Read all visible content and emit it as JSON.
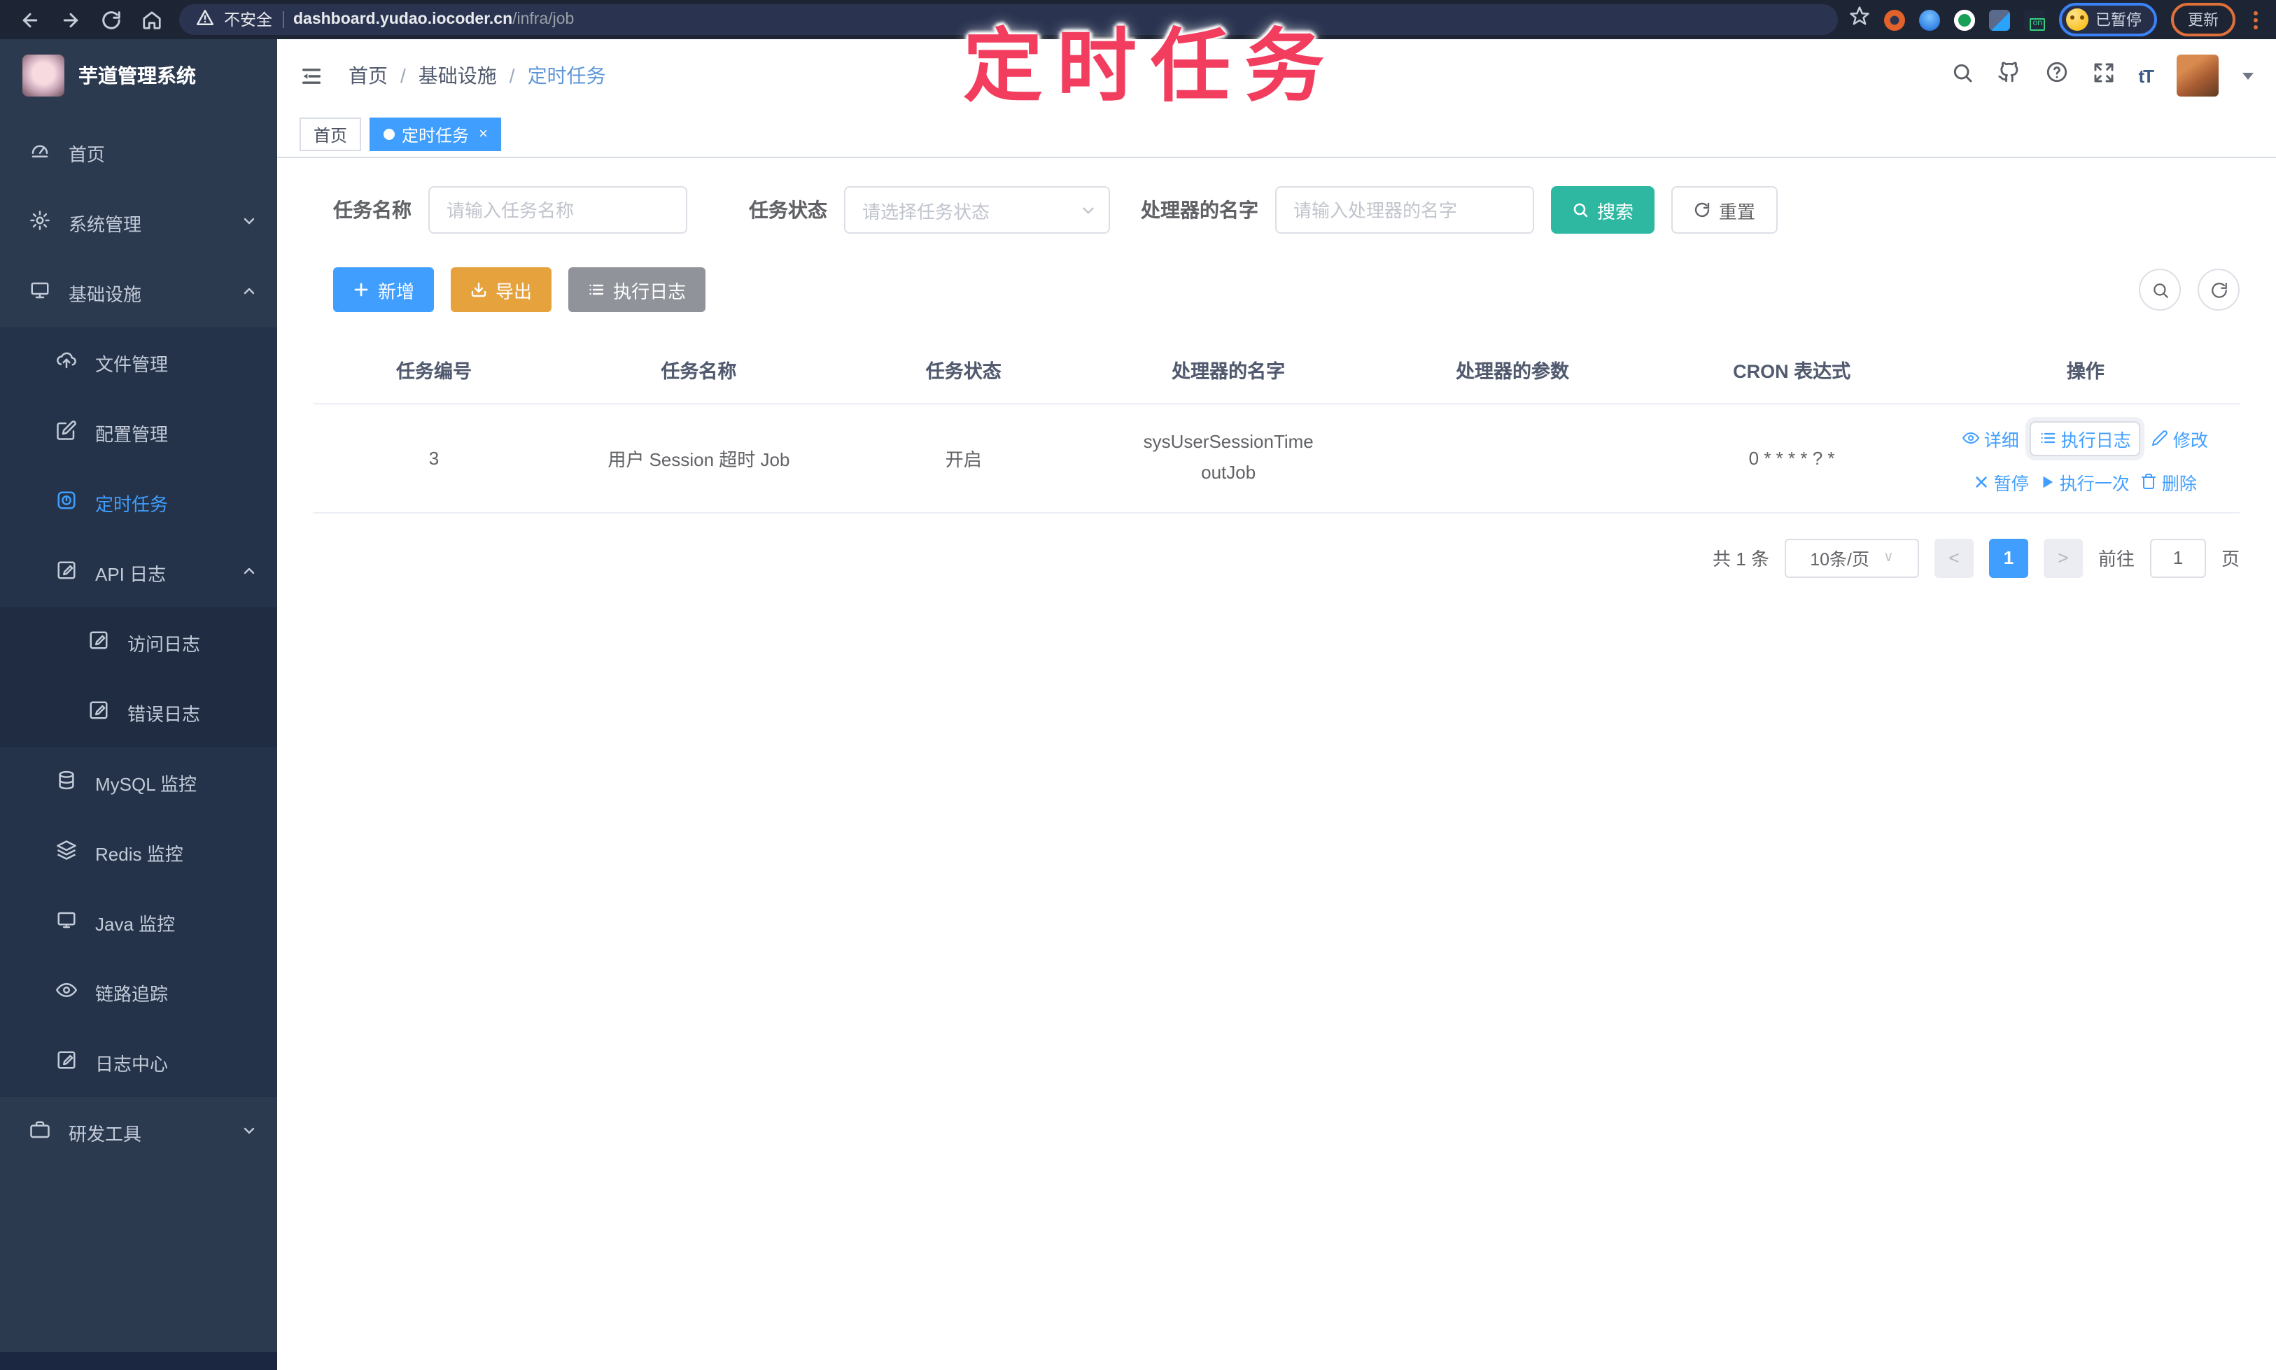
{
  "colors": {
    "accent": "#409eff",
    "search_button": "#2eb8a2",
    "export_button": "#e6a23c",
    "info_button": "#909399",
    "overlay_red": "#f23d5e",
    "sidebar_bg": "#2c3a50"
  },
  "overlay_text": "定时任务",
  "browser": {
    "security_label": "不安全",
    "url_domain": "dashboard.yudao.iocoder.cn",
    "url_path": "/infra/job",
    "ext_on_badge": "on",
    "profile_label": "已暂停",
    "update_label": "更新"
  },
  "sidebar": {
    "title": "芋道管理系统",
    "items": [
      {
        "label": "首页"
      },
      {
        "label": "系统管理"
      },
      {
        "label": "基础设施"
      },
      {
        "label": "文件管理"
      },
      {
        "label": "配置管理"
      },
      {
        "label": "定时任务"
      },
      {
        "label": "API 日志"
      },
      {
        "label": "访问日志"
      },
      {
        "label": "错误日志"
      },
      {
        "label": "MySQL 监控"
      },
      {
        "label": "Redis 监控"
      },
      {
        "label": "Java 监控"
      },
      {
        "label": "链路追踪"
      },
      {
        "label": "日志中心"
      },
      {
        "label": "研发工具"
      }
    ]
  },
  "breadcrumb": {
    "items": [
      "首页",
      "基础设施",
      "定时任务"
    ],
    "separator": "/"
  },
  "tabs": [
    {
      "label": "首页"
    },
    {
      "label": "定时任务",
      "close": "×"
    }
  ],
  "filters": {
    "name_label": "任务名称",
    "name_placeholder": "请输入任务名称",
    "status_label": "任务状态",
    "status_placeholder": "请选择任务状态",
    "handler_label": "处理器的名字",
    "handler_placeholder": "请输入处理器的名字",
    "search_label": "搜索",
    "reset_label": "重置"
  },
  "actions": {
    "add_label": "新增",
    "export_label": "导出",
    "exec_log_label": "执行日志"
  },
  "table": {
    "columns": [
      "任务编号",
      "任务名称",
      "任务状态",
      "处理器的名字",
      "处理器的参数",
      "CRON 表达式",
      "操作"
    ],
    "rows": [
      {
        "id": "3",
        "name": "用户 Session 超时 Job",
        "status": "开启",
        "handler": "sysUserSessionTimeoutJob",
        "param": "",
        "cron": "0 * * * * ? *"
      }
    ],
    "row_actions": {
      "detail": "详细",
      "exec_log": "执行日志",
      "edit": "修改",
      "pause": "暂停",
      "run_once": "执行一次",
      "delete": "删除"
    }
  },
  "pagination": {
    "total": "共 1 条",
    "page_size": "10条/页",
    "page": "1",
    "goto_label": "前往",
    "goto_value": "1",
    "page_suffix": "页"
  }
}
